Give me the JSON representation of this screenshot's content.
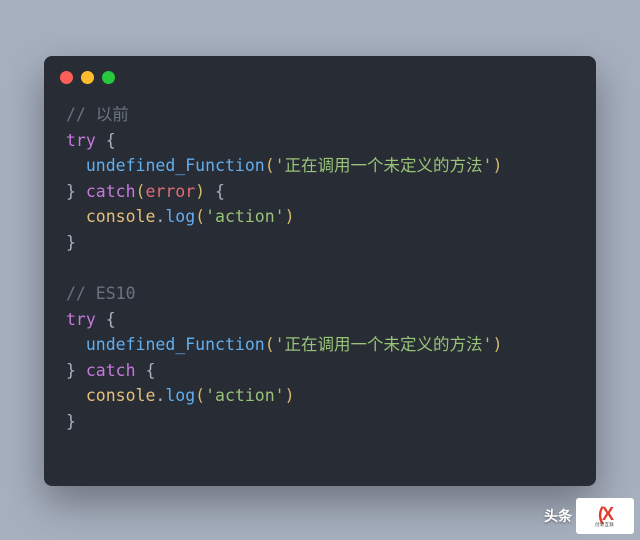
{
  "window": {
    "dots": [
      "red",
      "yellow",
      "green"
    ]
  },
  "code": {
    "comment1": "// 以前",
    "try": "try",
    "brace_open": " {",
    "brace_close": "}",
    "indent": "  ",
    "func": "undefined_Function",
    "lparen": "(",
    "rparen": ")",
    "string1": "'正在调用一个未定义的方法'",
    "catch": " catch",
    "error_paren_l": "(",
    "error_var": "error",
    "error_paren_r": ")",
    "console": "console",
    "dot": ".",
    "log": "log",
    "string2": "'action'",
    "comment2": "// ES10"
  },
  "footer": {
    "label": "头条",
    "logo_big": "(X",
    "logo_small_top": "创新互联",
    "logo_small_bottom": "CXHLCX"
  }
}
